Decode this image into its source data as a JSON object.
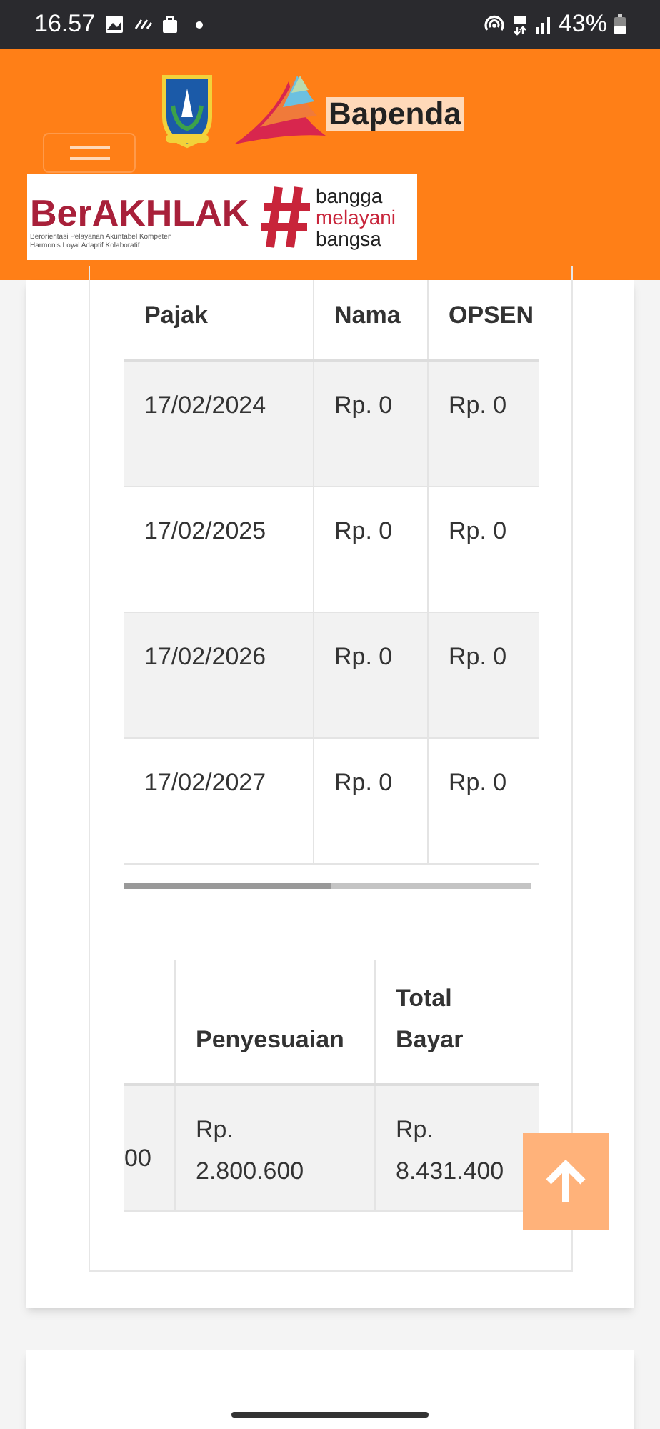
{
  "status_bar": {
    "time": "16.57",
    "battery": "43%"
  },
  "header": {
    "logo_text": "Bapenda",
    "banner": {
      "title": "BerAKHLAK",
      "tagline_1": "Berorientasi Pelayanan Akuntabel Kompeten",
      "tagline_2": "Harmonis Loyal Adaptif Kolaboratif",
      "slogan": [
        "bangga",
        "melayani",
        "bangsa"
      ]
    }
  },
  "table_1": {
    "columns": [
      "Pajak",
      "Nama",
      "OPSEN"
    ],
    "rows": [
      {
        "cells": [
          "17/02/2024",
          "Rp. 0",
          "Rp. 0"
        ]
      },
      {
        "cells": [
          "17/02/2025",
          "Rp. 0",
          "Rp. 0"
        ]
      },
      {
        "cells": [
          "17/02/2026",
          "Rp. 0",
          "Rp. 0"
        ]
      },
      {
        "cells": [
          "17/02/2027",
          "Rp. 0",
          "Rp. 0"
        ]
      }
    ]
  },
  "table_2": {
    "columns": [
      "",
      "Penyesuaian",
      "Total Bayar"
    ],
    "rows": [
      {
        "cells": [
          "00",
          "Rp. 2.800.600",
          "Rp. 8.431.400"
        ]
      }
    ]
  }
}
